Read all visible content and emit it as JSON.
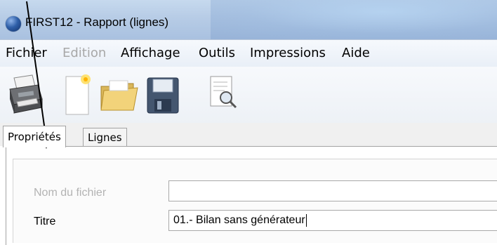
{
  "window": {
    "title": "FIRST12 - Rapport (lignes)"
  },
  "menu": {
    "items": [
      {
        "label": "Fichier",
        "disabled": false
      },
      {
        "label": "Edition",
        "disabled": true
      },
      {
        "label": "Affichage",
        "disabled": false
      },
      {
        "label": "Outils",
        "disabled": false
      },
      {
        "label": "Impressions",
        "disabled": false
      },
      {
        "label": "Aide",
        "disabled": false
      }
    ]
  },
  "toolbar": {
    "icons": [
      "printer-icon",
      "new-document-icon",
      "open-folder-icon",
      "save-disk-icon",
      "print-preview-icon"
    ]
  },
  "tabs": [
    {
      "label": "Propriétés",
      "active": true
    },
    {
      "label": "Lignes",
      "active": false
    }
  ],
  "form": {
    "filename": {
      "label": "Nom du fichier",
      "value": ""
    },
    "title": {
      "label": "Titre",
      "value": "01.- Bilan sans générateur"
    }
  },
  "colors": {
    "titlebar": "#b7cce6",
    "disabled_text": "#a8a8a8",
    "annotation_arrow": "#000000"
  }
}
